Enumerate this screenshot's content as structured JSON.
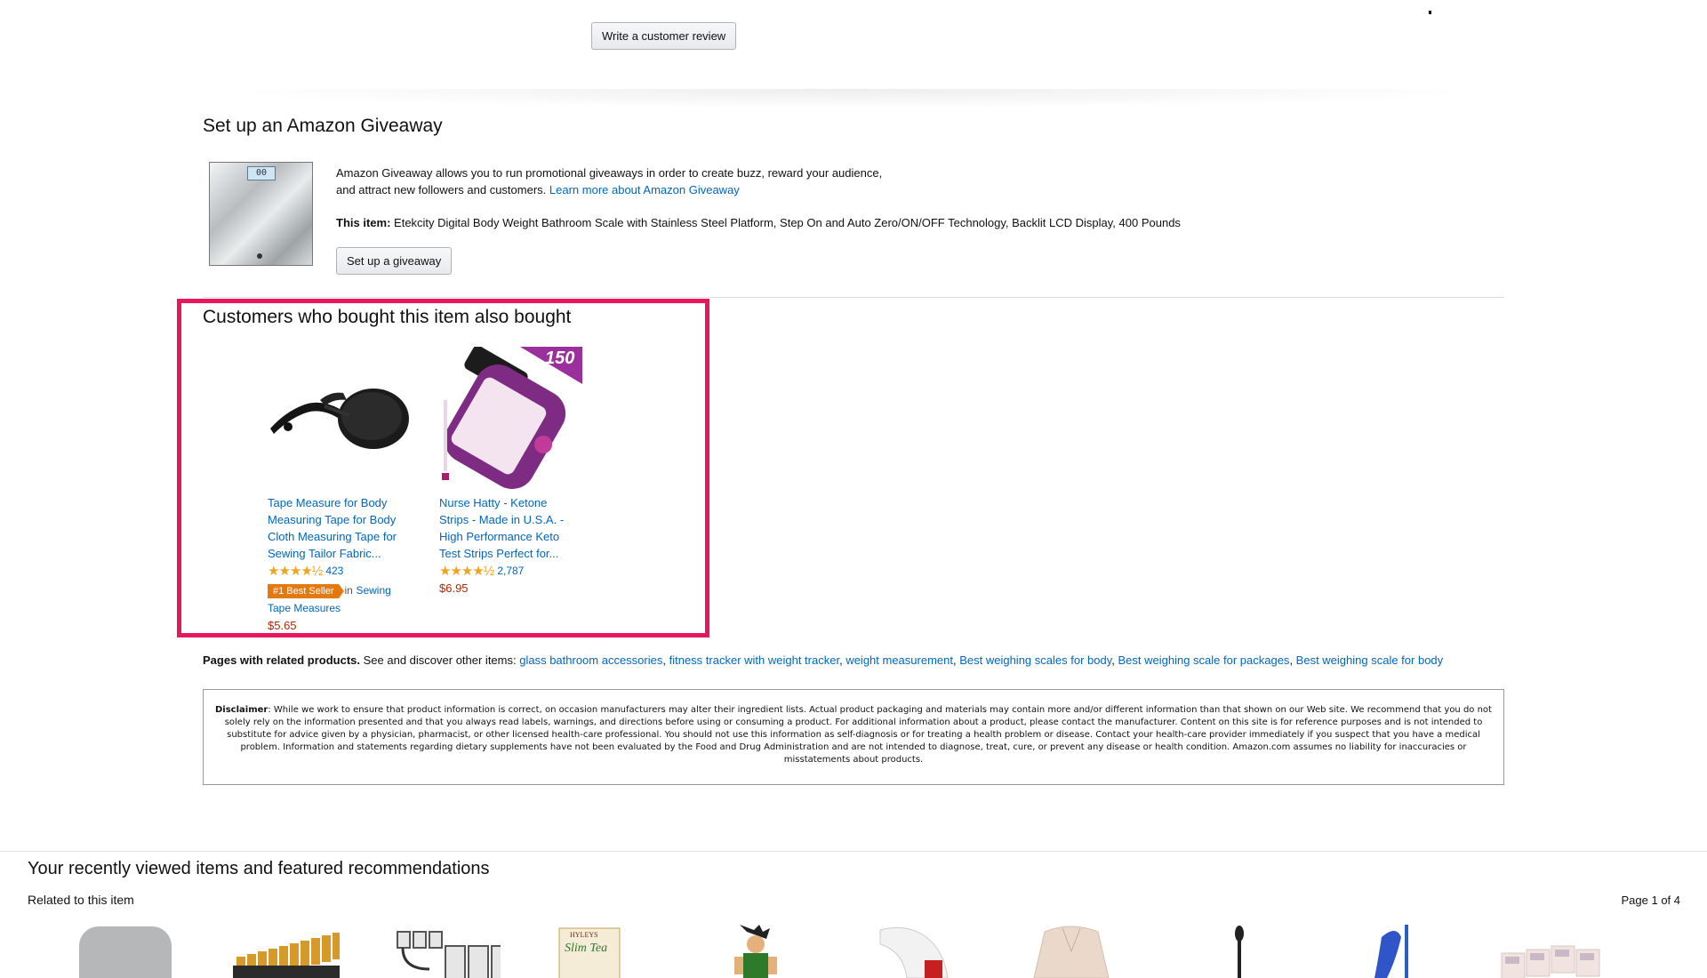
{
  "review_button": "Write a customer review",
  "giveaway": {
    "title": "Set up an Amazon Giveaway",
    "description_line1": "Amazon Giveaway allows you to run promotional giveaways in order to create buzz, reward your audience,",
    "description_line2": "and attract new followers and customers.",
    "learn_more": "Learn more about Amazon Giveaway",
    "item_label": "This item:",
    "item_text": "Etekcity Digital Body Weight Bathroom Scale with Stainless Steel Platform, Step On and Auto Zero/ON/OFF Technology, Backlit LCD Display, 400 Pounds",
    "lcd_text": "00",
    "button": "Set up a giveaway"
  },
  "also_bought": {
    "title": "Customers who bought this item also bought",
    "products": [
      {
        "title_lines": [
          "Tape Measure for Body",
          "Measuring Tape for Body",
          "Cloth Measuring Tape for",
          "Sewing Tailor Fabric..."
        ],
        "stars": "★★★★½",
        "rating": 4.5,
        "review_count": "423",
        "badge": "#1 Best Seller",
        "badge_in": "in",
        "badge_category_line1": "Sewing",
        "badge_category_line2": "Tape Measures",
        "price": "$5.65"
      },
      {
        "title_lines": [
          "Nurse Hatty - Ketone",
          "Strips - Made in U.S.A. -",
          "High Performance Keto",
          "Test Strips Perfect for..."
        ],
        "stars": "★★★★½",
        "rating": 4.5,
        "review_count": "2,787",
        "price": "$6.95",
        "image_label": "150"
      }
    ]
  },
  "related_pages": {
    "label": "Pages with related products.",
    "intro": "See and discover other items:",
    "links": [
      "glass bathroom accessories",
      "fitness tracker with weight tracker",
      "weight measurement",
      "Best weighing scales for body",
      "Best weighing scale for packages",
      "Best weighing scale for body"
    ]
  },
  "disclaimer": {
    "label": "Disclaimer",
    "text": ": While we work to ensure that product information is correct, on occasion manufacturers may alter their ingredient lists. Actual product packaging and materials may contain more and/or different information than that shown on our Web site. We recommend that you do not solely rely on the information presented and that you always read labels, warnings, and directions before using or consuming a product. For additional information about a product, please contact the manufacturer. Content on this site is for reference purposes and is not intended to substitute for advice given by a physician, pharmacist, or other licensed health-care professional. You should not use this information as self-diagnosis or for treating a health problem or disease. Contact your health-care provider immediately if you suspect that you have a medical problem. Information and statements regarding dietary supplements have not been evaluated by the Food and Drug Administration and are not intended to diagnose, treat, cure, or prevent any disease or health condition. Amazon.com assumes no liability for inaccuracies or misstatements about products."
  },
  "recently_viewed": {
    "title": "Your recently viewed items and featured recommendations",
    "subtitle": "Related to this item",
    "page_indicator": "Page 1 of 4",
    "thumb_brand": "HYLEYS",
    "thumb_product": "Slim Tea",
    "items": [
      "bathroom-scale",
      "aa-batteries",
      "usb-cables",
      "slim-tea",
      "action-figure",
      "soap-dispenser",
      "cardigan",
      "cotton-swab",
      "duster",
      "tissue-packs"
    ]
  },
  "colors": {
    "link": "#0066c0",
    "price": "#b12704",
    "badge": "#e47911",
    "highlight": "#e8175d",
    "stars": "#f0a41c"
  }
}
